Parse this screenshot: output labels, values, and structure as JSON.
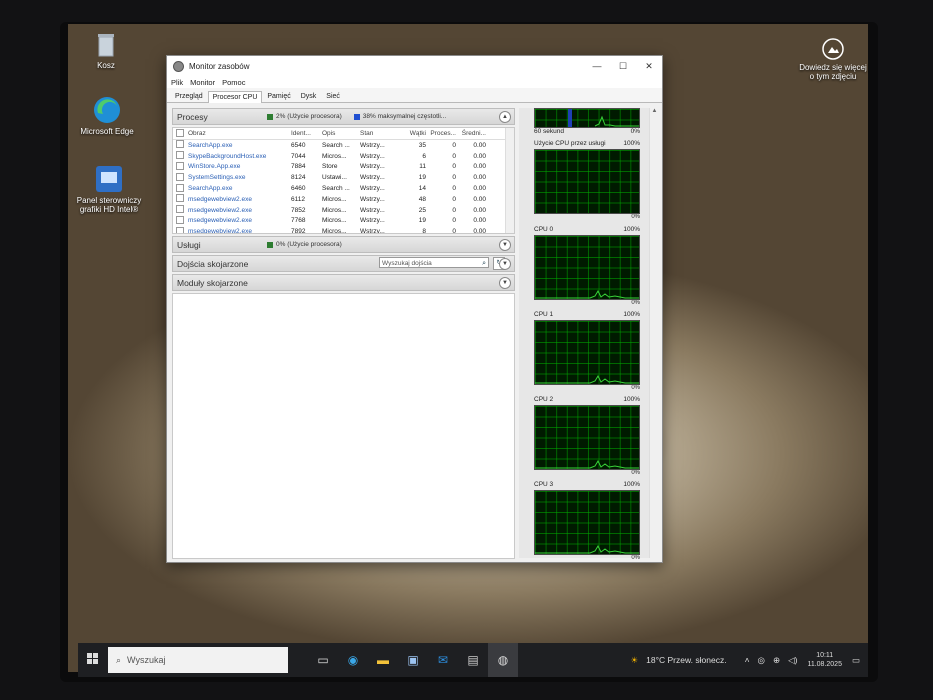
{
  "desktop": {
    "icons": [
      {
        "label": "Kosz"
      },
      {
        "label": "Microsoft Edge"
      },
      {
        "label": "Panel sterowniczy grafiki HD Intel®"
      }
    ],
    "corner_label": "Dowiedz się więcej o tym zdjęciu"
  },
  "window": {
    "title": "Monitor zasobów",
    "controls": {
      "minimize": "—",
      "maximize": "☐",
      "close": "✕"
    },
    "menu": [
      "Plik",
      "Monitor",
      "Pomoc"
    ],
    "tabs": [
      "Przegląd",
      "Procesor CPU",
      "Pamięć",
      "Dysk",
      "Sieć"
    ],
    "active_tab": "Procesor CPU",
    "processes": {
      "title": "Procesy",
      "stat1": "2% (Użycie procesora)",
      "stat1_color": "#2e7d32",
      "stat2": "38% maksymalnej częstotli...",
      "stat2_color": "#1f4fd1",
      "columns": [
        "Obraz",
        "Ident...",
        "Opis",
        "Stan",
        "Wątki",
        "Proces...",
        "Średni..."
      ],
      "rows": [
        [
          "SearchApp.exe",
          "6540",
          "Search ...",
          "Wstrzy...",
          "35",
          "0",
          "0.00"
        ],
        [
          "SkypeBackgroundHost.exe",
          "7044",
          "Micros...",
          "Wstrzy...",
          "6",
          "0",
          "0.00"
        ],
        [
          "WinStore.App.exe",
          "7884",
          "Store",
          "Wstrzy...",
          "11",
          "0",
          "0.00"
        ],
        [
          "SystemSettings.exe",
          "8124",
          "Ustawi...",
          "Wstrzy...",
          "19",
          "0",
          "0.00"
        ],
        [
          "SearchApp.exe",
          "6460",
          "Search ...",
          "Wstrzy...",
          "14",
          "0",
          "0.00"
        ],
        [
          "msedgewebview2.exe",
          "6112",
          "Micros...",
          "Wstrzy...",
          "48",
          "0",
          "0.00"
        ],
        [
          "msedgewebview2.exe",
          "7852",
          "Micros...",
          "Wstrzy...",
          "25",
          "0",
          "0.00"
        ],
        [
          "msedgewebview2.exe",
          "7768",
          "Micros...",
          "Wstrzy...",
          "19",
          "0",
          "0.00"
        ],
        [
          "msedgewebview2.exe",
          "7892",
          "Micros...",
          "Wstrzy...",
          "8",
          "0",
          "0.00"
        ],
        [
          "msedgewebview2.exe",
          "4636",
          "Micros...",
          "Wstrzy...",
          "14",
          "0",
          "0.00"
        ]
      ]
    },
    "services": {
      "title": "Usługi",
      "stat": "0% (Użycie procesora)",
      "stat_color": "#2e7d32"
    },
    "handles": {
      "title": "Dojścia skojarzone",
      "search_placeholder": "Wyszukaj dojścia"
    },
    "modules": {
      "title": "Moduły skojarzone"
    },
    "graphs": {
      "top": {
        "left": "60 sekund",
        "right": "0%"
      },
      "service": {
        "title": "Użycie CPU przez usługi",
        "max": "100%",
        "min": "0%"
      },
      "cpus": [
        {
          "title": "CPU 0",
          "max": "100%",
          "min": "0%"
        },
        {
          "title": "CPU 1",
          "max": "100%",
          "min": "0%"
        },
        {
          "title": "CPU 2",
          "max": "100%",
          "min": "0%"
        },
        {
          "title": "CPU 3",
          "max": "100%",
          "min": "0%"
        }
      ]
    }
  },
  "taskbar": {
    "search_placeholder": "Wyszukaj",
    "weather": "18°C  Przew. słonecz.",
    "time": "10:11",
    "date": "11.08.2025"
  }
}
